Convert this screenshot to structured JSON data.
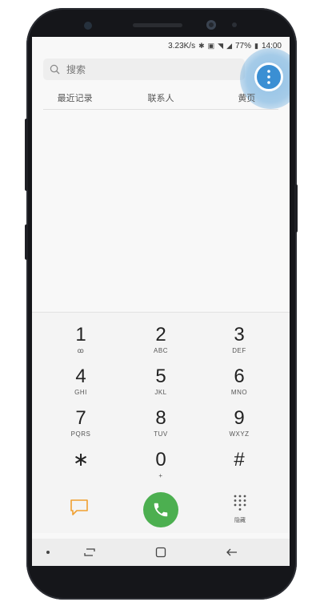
{
  "status_bar": {
    "net_speed": "3.23K/s",
    "battery": "77%",
    "time": "14:00"
  },
  "search": {
    "placeholder": "搜索"
  },
  "tabs": [
    {
      "label": "最近记录"
    },
    {
      "label": "联系人"
    },
    {
      "label": "黄页"
    }
  ],
  "keypad": {
    "keys": [
      {
        "digit": "1",
        "letters": "ꝏ"
      },
      {
        "digit": "2",
        "letters": "ABC"
      },
      {
        "digit": "3",
        "letters": "DEF"
      },
      {
        "digit": "4",
        "letters": "GHI"
      },
      {
        "digit": "5",
        "letters": "JKL"
      },
      {
        "digit": "6",
        "letters": "MNO"
      },
      {
        "digit": "7",
        "letters": "PQRS"
      },
      {
        "digit": "8",
        "letters": "TUV"
      },
      {
        "digit": "9",
        "letters": "WXYZ"
      },
      {
        "digit": "∗",
        "letters": ""
      },
      {
        "digit": "0",
        "letters": "+"
      },
      {
        "digit": "#",
        "letters": ""
      }
    ]
  },
  "actions": {
    "hide_label": "隐藏"
  },
  "colors": {
    "call_green": "#4caf50",
    "message_orange": "#f0a030",
    "highlight_blue": "#3b8fd3"
  },
  "icons": {
    "search": "search-icon",
    "more": "more-options-icon",
    "message": "message-icon",
    "call": "phone-icon",
    "hide": "dialpad-icon",
    "nav_recent": "recent-apps-icon",
    "nav_home": "home-icon",
    "nav_back": "back-icon"
  }
}
